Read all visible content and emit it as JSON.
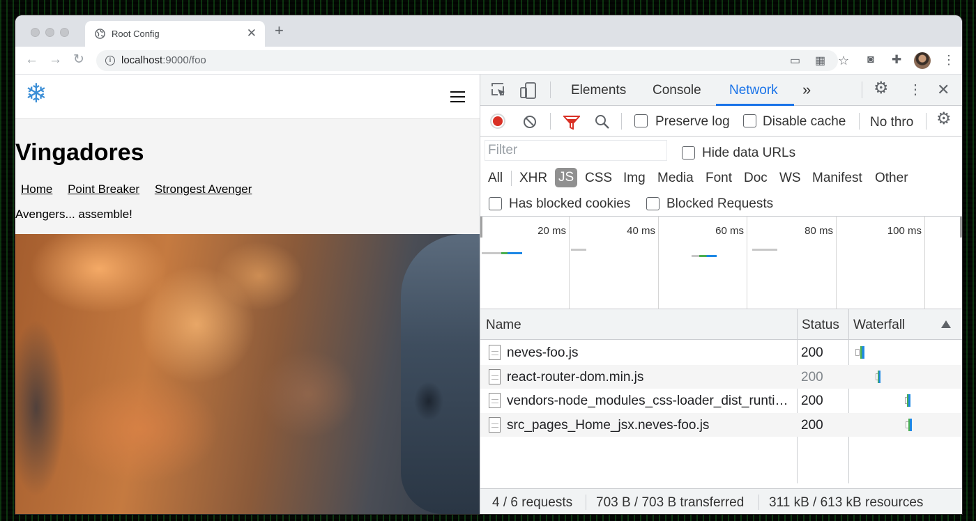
{
  "browser": {
    "tab_title": "Root Config",
    "tab_close": "✕",
    "new_tab": "+",
    "url_host": "localhost",
    "url_rest": ":9000/foo"
  },
  "page": {
    "title": "Vingadores",
    "nav": [
      "Home",
      "Point Breaker",
      "Strongest Avenger"
    ],
    "tagline": "Avengers... assemble!",
    "logo_glyph": "❄"
  },
  "devtools": {
    "tabs": [
      "Elements",
      "Console",
      "Network"
    ],
    "active_tab": "Network",
    "more": "»",
    "toolbar": {
      "preserve_log": "Preserve log",
      "disable_cache": "Disable cache",
      "throttle": "No thro"
    },
    "filter_placeholder": "Filter",
    "hide_data_urls": "Hide data URLs",
    "types": [
      "All",
      "XHR",
      "JS",
      "CSS",
      "Img",
      "Media",
      "Font",
      "Doc",
      "WS",
      "Manifest",
      "Other"
    ],
    "active_type": "JS",
    "has_blocked_cookies": "Has blocked cookies",
    "blocked_requests": "Blocked Requests",
    "overview_ticks": [
      "20 ms",
      "40 ms",
      "60 ms",
      "80 ms",
      "100 ms"
    ],
    "columns": {
      "name": "Name",
      "status": "Status",
      "waterfall": "Waterfall"
    },
    "requests": [
      {
        "name": "neves-foo.js",
        "status": "200",
        "status_dim": false
      },
      {
        "name": "react-router-dom.min.js",
        "status": "200",
        "status_dim": true
      },
      {
        "name": "vendors-node_modules_css-loader_dist_runtime_api_js-node_modules_css-loader_dist_runtime_cssWithMappingToString_js.js",
        "status": "200",
        "status_dim": false
      },
      {
        "name": "src_pages_Home_jsx.neves-foo.js",
        "status": "200",
        "status_dim": false
      }
    ],
    "status_bar": {
      "requests": "4 / 6 requests",
      "transferred": "703 B / 703 B transferred",
      "resources": "311 kB / 613 kB resources"
    }
  },
  "colors": {
    "accent": "#1a73e8",
    "record": "#d93025",
    "logo": "#3b8ed6"
  }
}
